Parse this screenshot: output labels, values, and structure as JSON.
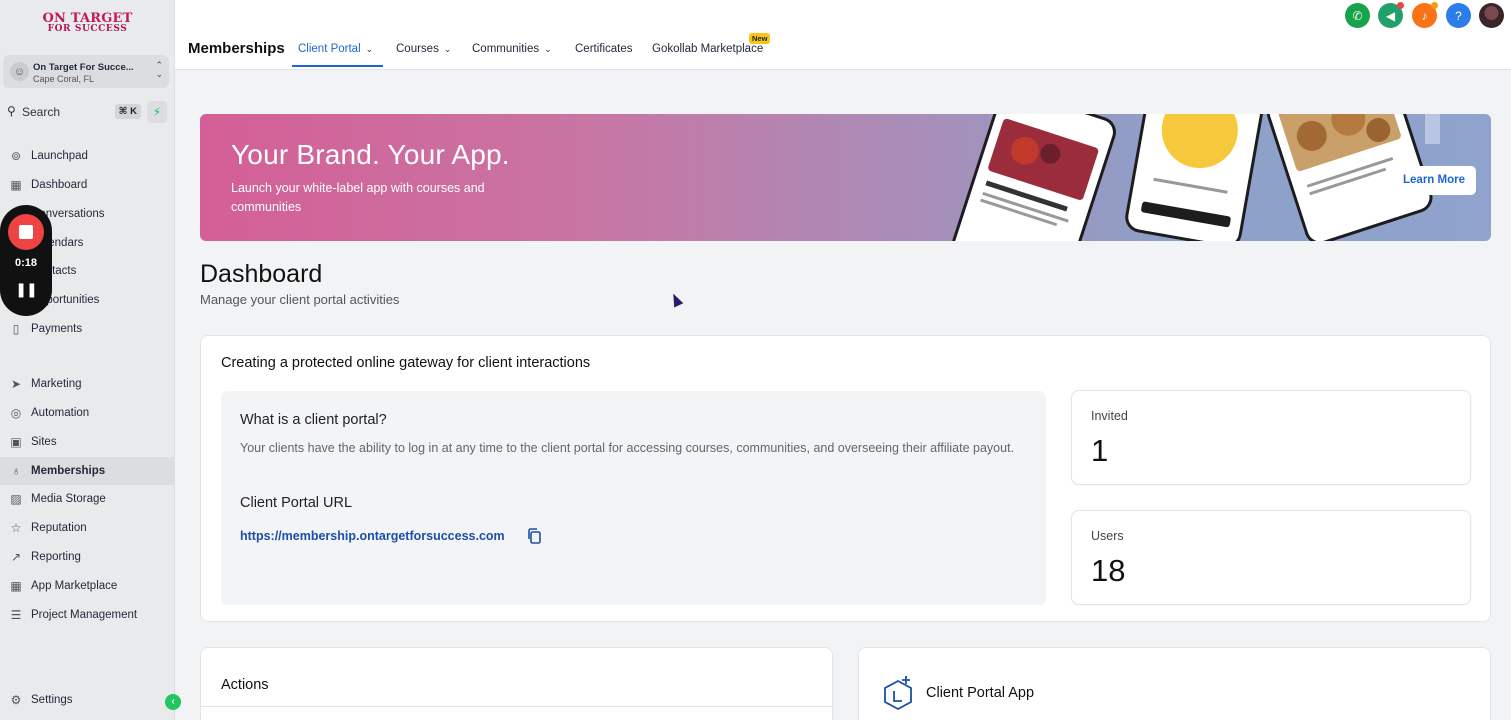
{
  "sidebar": {
    "logo": {
      "line1": "ON TARGET",
      "line2": "FOR SUCCESS"
    },
    "account": {
      "name": "On Target For Succe...",
      "location": "Cape Coral, FL"
    },
    "search": {
      "label": "Search",
      "shortcut": "⌘ K"
    },
    "items": [
      {
        "label": "Launchpad",
        "icon": "rocket-icon"
      },
      {
        "label": "Dashboard",
        "icon": "grid-icon"
      },
      {
        "label": "Conversations",
        "icon": "chat-icon"
      },
      {
        "label": "Calendars",
        "icon": "calendar-icon"
      },
      {
        "label": "Contacts",
        "icon": "contacts-icon"
      },
      {
        "label": "Opportunities",
        "icon": "funnel-icon"
      },
      {
        "label": "Payments",
        "icon": "payments-icon"
      },
      {
        "label": "Marketing",
        "icon": "send-icon"
      },
      {
        "label": "Automation",
        "icon": "automation-icon"
      },
      {
        "label": "Sites",
        "icon": "sites-icon"
      },
      {
        "label": "Memberships",
        "icon": "award-icon"
      },
      {
        "label": "Media Storage",
        "icon": "image-icon"
      },
      {
        "label": "Reputation",
        "icon": "star-icon"
      },
      {
        "label": "Reporting",
        "icon": "chart-icon"
      },
      {
        "label": "App Marketplace",
        "icon": "apps-icon"
      },
      {
        "label": "Project Management",
        "icon": "list-icon"
      }
    ],
    "settings": "Settings"
  },
  "recorder": {
    "time": "0:18"
  },
  "topbar": {
    "title": "Memberships",
    "tabs": [
      {
        "label": "Client Portal"
      },
      {
        "label": "Courses"
      },
      {
        "label": "Communities"
      },
      {
        "label": "Certificates"
      },
      {
        "label": "Gokollab Marketplace"
      }
    ],
    "new_badge": "New",
    "help": "?"
  },
  "banner": {
    "title": "Your Brand. Your App.",
    "subtitle": "Launch your white-label app with courses and communities",
    "cta": "Learn More"
  },
  "dashboard": {
    "title": "Dashboard",
    "subtitle": "Manage your client portal activities"
  },
  "gateway": {
    "title": "Creating a protected online gateway for client interactions",
    "question": "What is a client portal?",
    "description": "Your clients have the ability to log in at any time to the client portal for accessing courses, communities, and overseeing their affiliate payout.",
    "url_heading": "Client Portal URL",
    "url": "https://membership.ontargetforsuccess.com"
  },
  "stats": [
    {
      "label": "Invited",
      "value": "1"
    },
    {
      "label": "Users",
      "value": "18"
    }
  ],
  "actions": {
    "title": "Actions"
  },
  "client_app": {
    "title": "Client Portal App"
  },
  "colors": {
    "accent": "#1b66d2",
    "recorder_red": "#ef4444",
    "green": "#22c55e"
  }
}
